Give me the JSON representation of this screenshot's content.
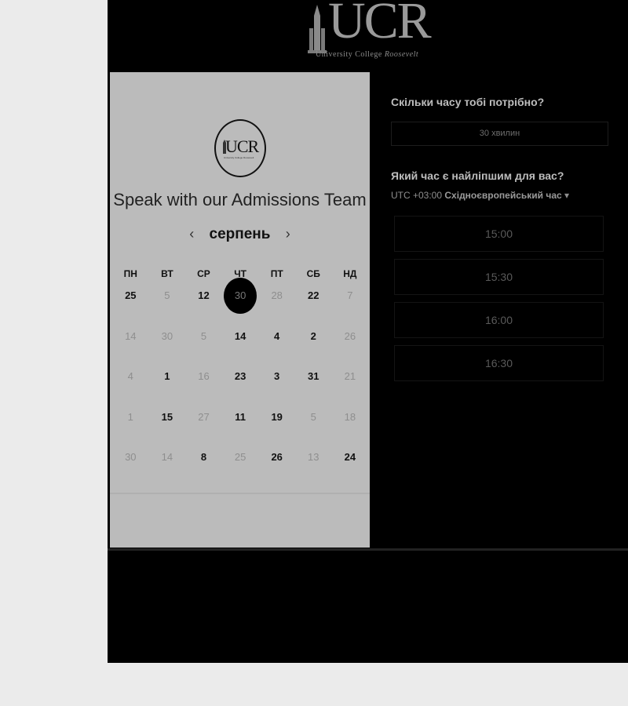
{
  "header": {
    "logo_text": "UCR",
    "logo_subtitle": "University College",
    "logo_subtitle_script": "Roosevelt"
  },
  "card": {
    "logo_text": "UCR",
    "logo_small_text": "University College Roosevelt",
    "title": "Speak with our Admissions Team",
    "month": "серпень",
    "prev_icon": "‹",
    "next_icon": "›"
  },
  "calendar": {
    "weekdays": [
      "ПН",
      "ВТ",
      "СР",
      "ЧТ",
      "ПТ",
      "СБ",
      "НД"
    ],
    "rows": [
      [
        {
          "t": "25",
          "s": "on"
        },
        {
          "t": "5",
          "s": "off"
        },
        {
          "t": "12",
          "s": "on"
        },
        {
          "t": "30",
          "s": "sel"
        },
        {
          "t": "28",
          "s": "off"
        },
        {
          "t": "22",
          "s": "on"
        },
        {
          "t": "7",
          "s": "off"
        }
      ],
      [
        {
          "t": "14",
          "s": "off"
        },
        {
          "t": "30",
          "s": "off"
        },
        {
          "t": "5",
          "s": "off"
        },
        {
          "t": "14",
          "s": "on"
        },
        {
          "t": "4",
          "s": "on"
        },
        {
          "t": "2",
          "s": "on"
        },
        {
          "t": "26",
          "s": "off"
        }
      ],
      [
        {
          "t": "4",
          "s": "off"
        },
        {
          "t": "1",
          "s": "on"
        },
        {
          "t": "16",
          "s": "off"
        },
        {
          "t": "23",
          "s": "on"
        },
        {
          "t": "3",
          "s": "on"
        },
        {
          "t": "31",
          "s": "on"
        },
        {
          "t": "21",
          "s": "off"
        }
      ],
      [
        {
          "t": "1",
          "s": "off"
        },
        {
          "t": "15",
          "s": "on"
        },
        {
          "t": "27",
          "s": "off"
        },
        {
          "t": "11",
          "s": "on"
        },
        {
          "t": "19",
          "s": "on"
        },
        {
          "t": "5",
          "s": "off"
        },
        {
          "t": "18",
          "s": "off"
        }
      ],
      [
        {
          "t": "30",
          "s": "off"
        },
        {
          "t": "14",
          "s": "off"
        },
        {
          "t": "8",
          "s": "on"
        },
        {
          "t": "25",
          "s": "off"
        },
        {
          "t": "26",
          "s": "on"
        },
        {
          "t": "13",
          "s": "off"
        },
        {
          "t": "24",
          "s": "on"
        }
      ]
    ]
  },
  "booking": {
    "duration_question": "Скільки часу тобі потрібно?",
    "duration_value": "30 хвилин",
    "time_question": "Який час є найліпшим для вас?",
    "timezone_prefix": "UTC +03:00",
    "timezone_name": "Східноєвропейський час",
    "timezone_caret": "▾",
    "slots": [
      "15:00",
      "15:30",
      "16:00",
      "16:30"
    ]
  }
}
